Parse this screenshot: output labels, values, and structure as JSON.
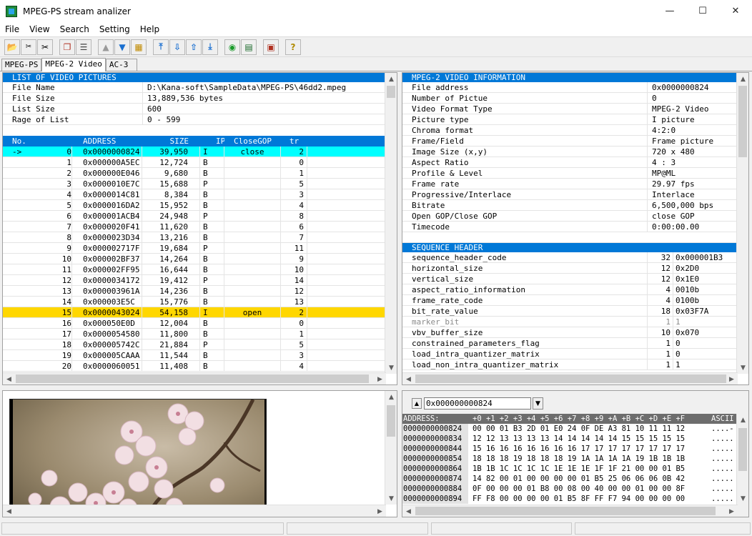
{
  "window": {
    "title": "MPEG-PS stream analizer",
    "minimize": "—",
    "maximize": "☐",
    "close": "✕"
  },
  "menu": [
    "File",
    "View",
    "Search",
    "Setting",
    "Help"
  ],
  "toolbar_icons": [
    "open-folder-icon",
    "cut-file-icon",
    "scissors-icon",
    "copy-icon",
    "list-icon",
    "up-triangle-icon",
    "down-triangle-icon",
    "grid-icon",
    "jump-top-icon",
    "jump-down-icon",
    "jump-up-icon",
    "jump-bottom-icon",
    "play-icon",
    "table-icon",
    "report-icon",
    "help-icon"
  ],
  "tabs": [
    "MPEG-PS",
    "MPEG-2 Video",
    "AC-3"
  ],
  "active_tab": 1,
  "list_info": {
    "header": "LIST OF VIDEO PICTURES",
    "rows": [
      {
        "k": "File Name",
        "v": "D:\\Kana-soft\\SampleData\\MPEG-PS\\46dd2.mpeg"
      },
      {
        "k": "File Size",
        "v": "13,889,536 bytes"
      },
      {
        "k": "List Size",
        "v": "600"
      },
      {
        "k": "Rage of List",
        "v": "0 - 599"
      }
    ]
  },
  "pictures": {
    "columns": [
      "No.",
      "ADDRESS",
      "SIZE",
      "IPB",
      "CloseGOP",
      "tr"
    ],
    "rows": [
      {
        "mark": "->",
        "no": "0",
        "addr": "0x0000000824",
        "size": "39,950",
        "ipb": "I",
        "gop": "close",
        "tr": "2",
        "state": "sel"
      },
      {
        "mark": "",
        "no": "1",
        "addr": "0x000000A5EC",
        "size": "12,724",
        "ipb": "B",
        "gop": "",
        "tr": "0",
        "state": ""
      },
      {
        "mark": "",
        "no": "2",
        "addr": "0x000000E046",
        "size": "9,680",
        "ipb": "B",
        "gop": "",
        "tr": "1",
        "state": ""
      },
      {
        "mark": "",
        "no": "3",
        "addr": "0x0000010E7C",
        "size": "15,688",
        "ipb": "P",
        "gop": "",
        "tr": "5",
        "state": ""
      },
      {
        "mark": "",
        "no": "4",
        "addr": "0x0000014C81",
        "size": "8,384",
        "ipb": "B",
        "gop": "",
        "tr": "3",
        "state": ""
      },
      {
        "mark": "",
        "no": "5",
        "addr": "0x0000016DA2",
        "size": "15,952",
        "ipb": "B",
        "gop": "",
        "tr": "4",
        "state": ""
      },
      {
        "mark": "",
        "no": "6",
        "addr": "0x000001ACB4",
        "size": "24,948",
        "ipb": "P",
        "gop": "",
        "tr": "8",
        "state": ""
      },
      {
        "mark": "",
        "no": "7",
        "addr": "0x0000020F41",
        "size": "11,620",
        "ipb": "B",
        "gop": "",
        "tr": "6",
        "state": ""
      },
      {
        "mark": "",
        "no": "8",
        "addr": "0x0000023D34",
        "size": "13,216",
        "ipb": "B",
        "gop": "",
        "tr": "7",
        "state": ""
      },
      {
        "mark": "",
        "no": "9",
        "addr": "0x000002717F",
        "size": "19,684",
        "ipb": "P",
        "gop": "",
        "tr": "11",
        "state": ""
      },
      {
        "mark": "",
        "no": "10",
        "addr": "0x000002BF37",
        "size": "14,264",
        "ipb": "B",
        "gop": "",
        "tr": "9",
        "state": ""
      },
      {
        "mark": "",
        "no": "11",
        "addr": "0x000002FF95",
        "size": "16,644",
        "ipb": "B",
        "gop": "",
        "tr": "10",
        "state": ""
      },
      {
        "mark": "",
        "no": "12",
        "addr": "0x0000034172",
        "size": "19,412",
        "ipb": "P",
        "gop": "",
        "tr": "14",
        "state": ""
      },
      {
        "mark": "",
        "no": "13",
        "addr": "0x000003961A",
        "size": "14,236",
        "ipb": "B",
        "gop": "",
        "tr": "12",
        "state": ""
      },
      {
        "mark": "",
        "no": "14",
        "addr": "0x000003E5C",
        "size": "15,776",
        "ipb": "B",
        "gop": "",
        "tr": "13",
        "state": ""
      },
      {
        "mark": "",
        "no": "15",
        "addr": "0x0000043024",
        "size": "54,158",
        "ipb": "I",
        "gop": "open",
        "tr": "2",
        "state": "hl"
      },
      {
        "mark": "",
        "no": "16",
        "addr": "0x000050E0D",
        "size": "12,004",
        "ipb": "B",
        "gop": "",
        "tr": "0",
        "state": ""
      },
      {
        "mark": "",
        "no": "17",
        "addr": "0x0000054580",
        "size": "11,800",
        "ipb": "B",
        "gop": "",
        "tr": "1",
        "state": ""
      },
      {
        "mark": "",
        "no": "18",
        "addr": "0x000005742C",
        "size": "21,884",
        "ipb": "P",
        "gop": "",
        "tr": "5",
        "state": ""
      },
      {
        "mark": "",
        "no": "19",
        "addr": "0x000005CAAA",
        "size": "11,544",
        "ipb": "B",
        "gop": "",
        "tr": "3",
        "state": ""
      },
      {
        "mark": "",
        "no": "20",
        "addr": "0x0000060051",
        "size": "11,408",
        "ipb": "B",
        "gop": "",
        "tr": "4",
        "state": ""
      }
    ]
  },
  "video_info": {
    "header": "MPEG-2 VIDEO INFORMATION",
    "rows": [
      {
        "k": "File address",
        "v": "0x0000000824"
      },
      {
        "k": "Number of Pictue",
        "v": "0"
      },
      {
        "k": "Video Format Type",
        "v": "MPEG-2 Video"
      },
      {
        "k": "Picture type",
        "v": "I picture"
      },
      {
        "k": "Chroma format",
        "v": "4:2:0"
      },
      {
        "k": "Frame/Field",
        "v": "Frame picture"
      },
      {
        "k": "Image Size (x,y)",
        "v": "720 x 480"
      },
      {
        "k": "Aspect Ratio",
        "v": "4 : 3"
      },
      {
        "k": "Profile & Level",
        "v": "MP@ML"
      },
      {
        "k": "Frame rate",
        "v": "29.97 fps"
      },
      {
        "k": "Progressive/Interlace",
        "v": "Interlace"
      },
      {
        "k": "Bitrate",
        "v": "6,500,000 bps"
      },
      {
        "k": "Open GOP/Close GOP",
        "v": "close GOP"
      },
      {
        "k": "Timecode",
        "v": "0:00:00.00"
      }
    ]
  },
  "seq_header": {
    "header": "SEQUENCE HEADER",
    "rows": [
      {
        "k": "sequence_header_code",
        "b": "32",
        "v": "0x000001B3",
        "dim": false
      },
      {
        "k": "horizontal_size",
        "b": "12",
        "v": "0x2D0",
        "dim": false
      },
      {
        "k": "vertical_size",
        "b": "12",
        "v": "0x1E0",
        "dim": false
      },
      {
        "k": "aspect_ratio_information",
        "b": "4",
        "v": "0010b",
        "dim": false
      },
      {
        "k": "frame_rate_code",
        "b": "4",
        "v": "0100b",
        "dim": false
      },
      {
        "k": "bit_rate_value",
        "b": "18",
        "v": "0x03F7A",
        "dim": false
      },
      {
        "k": "marker_bit",
        "b": "1",
        "v": "1",
        "dim": true
      },
      {
        "k": "vbv_buffer_size",
        "b": "10",
        "v": "0x070",
        "dim": false
      },
      {
        "k": "constrained_parameters_flag",
        "b": "1",
        "v": "0",
        "dim": false
      },
      {
        "k": "load_intra_quantizer_matrix",
        "b": "1",
        "v": "0",
        "dim": false
      },
      {
        "k": "load_non_intra_quantizer_matrix",
        "b": "1",
        "v": "1",
        "dim": false
      }
    ]
  },
  "hex": {
    "address_value": "0x000000000824",
    "header_addr": "ADDRESS:",
    "header_bytes": "+0 +1 +2 +3 +4 +5 +6 +7 +8 +9 +A +B +C +D +E +F",
    "header_ascii": "ASCII",
    "rows": [
      {
        "a": "0000000000824",
        "b": "00 00 01 B3 2D 01 E0 24 0F DE A3 81 10 11 11 12",
        "c": "....-"
      },
      {
        "a": "0000000000834",
        "b": "12 12 13 13 13 13 14 14 14 14 14 15 15 15 15 15",
        "c": "....."
      },
      {
        "a": "0000000000844",
        "b": "15 16 16 16 16 16 16 16 17 17 17 17 17 17 17 17",
        "c": "....."
      },
      {
        "a": "0000000000854",
        "b": "18 18 18 19 18 18 18 19 1A 1A 1A 1A 19 1B 1B 1B",
        "c": "....."
      },
      {
        "a": "0000000000864",
        "b": "1B 1B 1C 1C 1C 1C 1E 1E 1E 1F 1F 21 00 00 01 B5",
        "c": "....."
      },
      {
        "a": "0000000000874",
        "b": "14 82 00 01 00 00 00 00 01 B5 25 06 06 06 0B 42",
        "c": "....."
      },
      {
        "a": "0000000000884",
        "b": "0F 00 00 00 01 B8 00 08 00 40 00 00 01 00 00 8F",
        "c": "....."
      },
      {
        "a": "0000000000894",
        "b": "FF F8 00 00 00 00 01 B5 8F FF F7 94 00 00 00 00",
        "c": "....."
      }
    ]
  },
  "colors": {
    "header_blue": "#0078d7",
    "selected_row": "#00ffff",
    "highlight_row": "#ffd700"
  }
}
